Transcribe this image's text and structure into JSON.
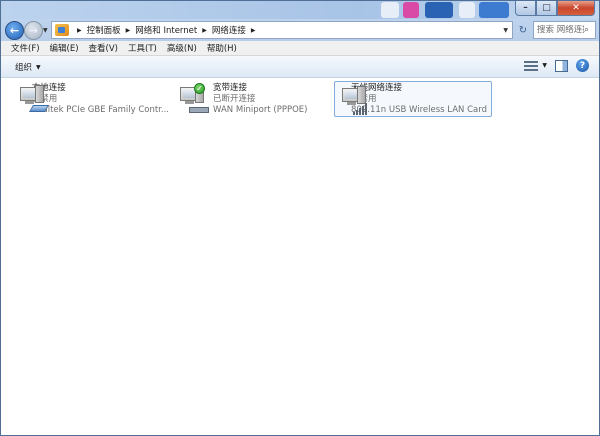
{
  "window": {
    "controls": {
      "minimize": "–",
      "maximize": "□",
      "close": "✕"
    }
  },
  "nav": {
    "back_icon": "arrow-left-icon",
    "forward_icon": "arrow-right-icon",
    "breadcrumbs": [
      "控制面板",
      "网络和 Internet",
      "网络连接"
    ],
    "search_placeholder": "搜索 网络连接"
  },
  "menu": {
    "items": [
      "文件(F)",
      "编辑(E)",
      "查看(V)",
      "工具(T)",
      "高级(N)",
      "帮助(H)"
    ]
  },
  "toolbar": {
    "organize_label": "组织"
  },
  "connections": [
    {
      "name": "本地连接",
      "status": "已禁用",
      "device": "Realtek PCIe GBE Family Contr...",
      "icon": "ethernet-adapter-icon"
    },
    {
      "name": "宽带连接",
      "status": "已断开连接",
      "device": "WAN Miniport (PPPOE)",
      "icon": "broadband-connection-icon"
    },
    {
      "name": "无线网络连接",
      "status": "已禁用",
      "device": "802.11n USB Wireless LAN Card",
      "icon": "wireless-adapter-icon",
      "selected": true
    }
  ],
  "colors": {
    "accent": "#84acdd",
    "status_ok": "#2a9a2a"
  }
}
